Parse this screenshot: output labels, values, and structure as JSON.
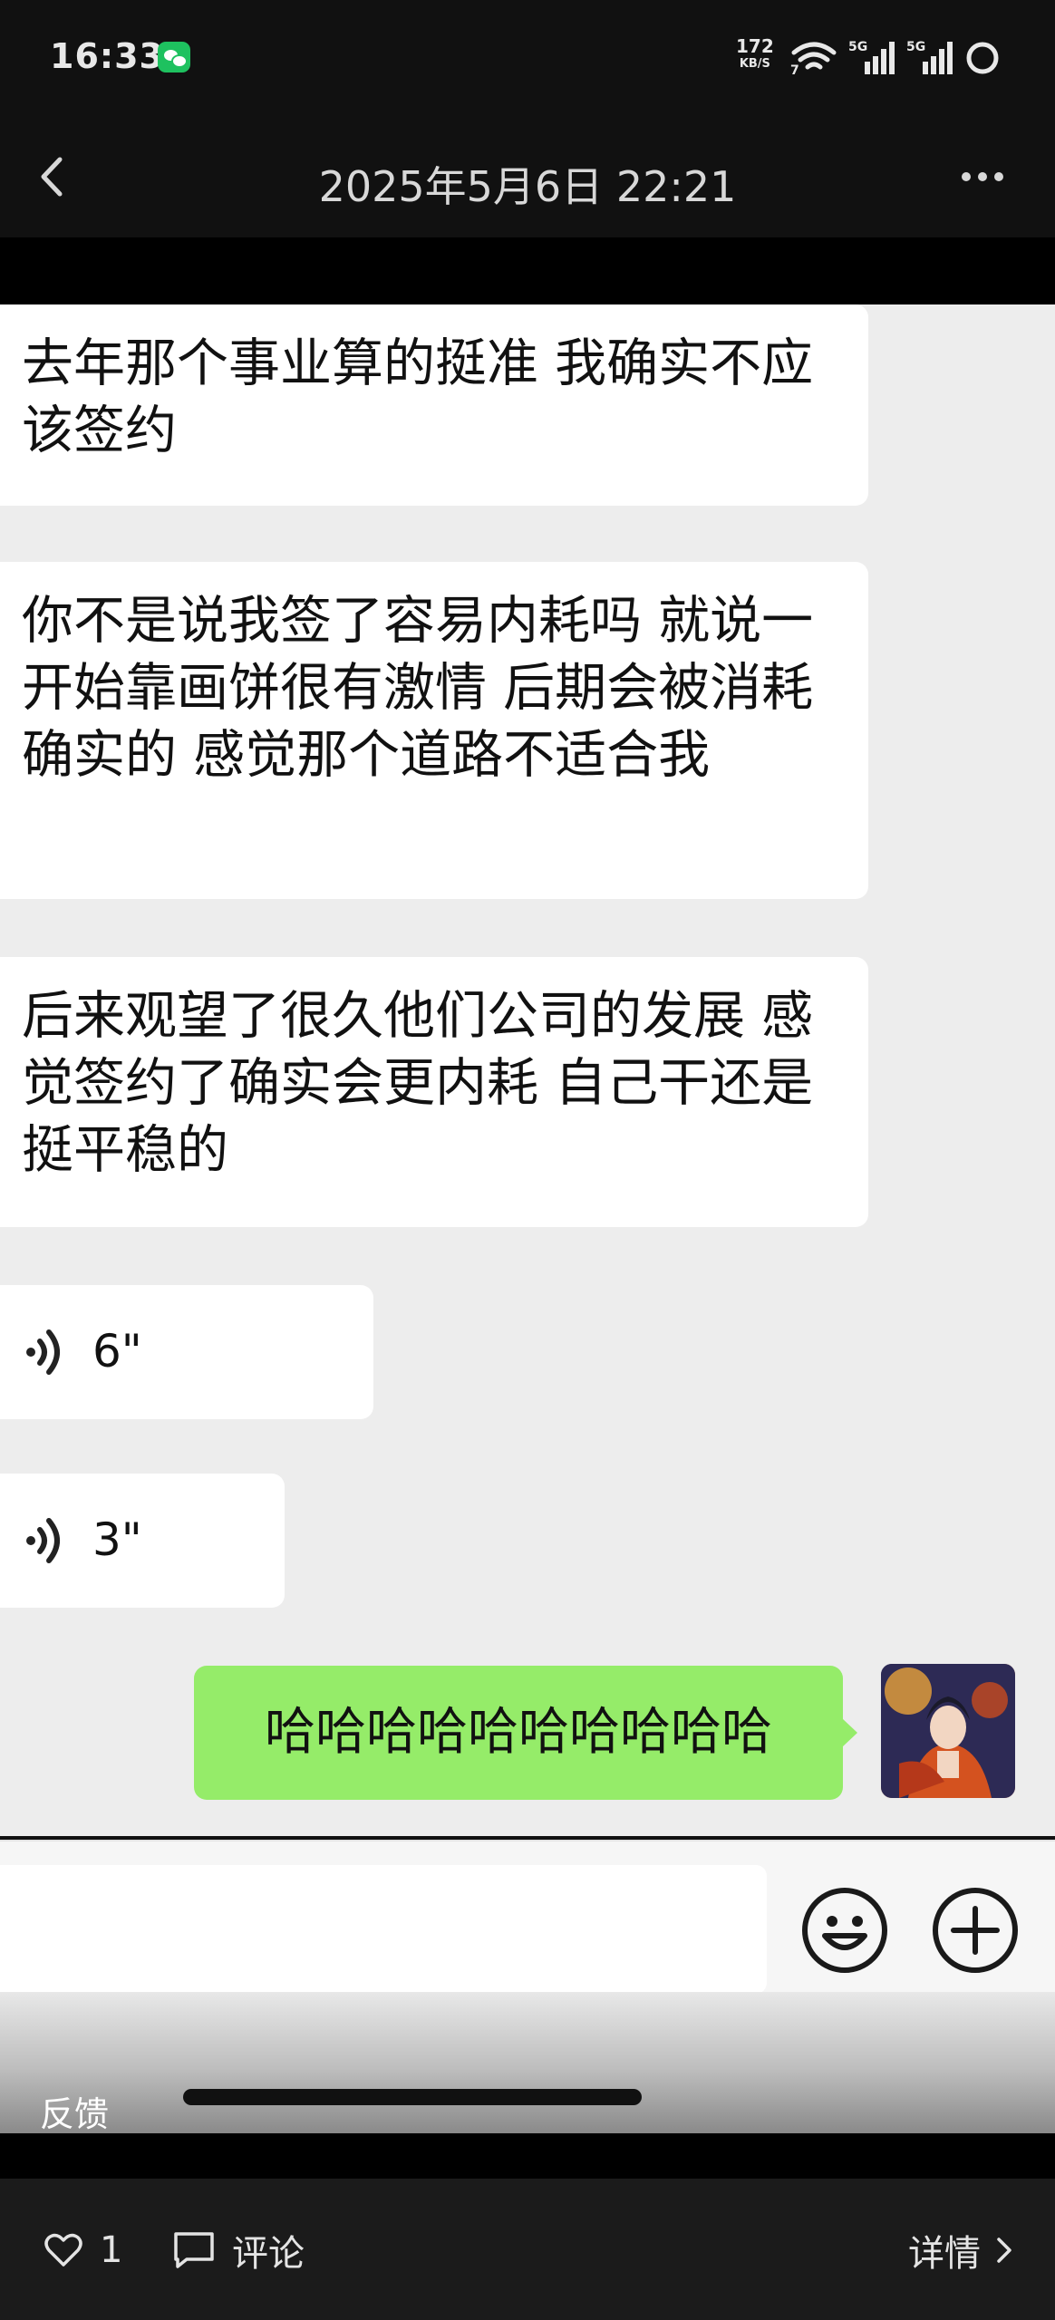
{
  "status_bar": {
    "time": "16:33",
    "net_speed_value": "172",
    "net_speed_unit": "KB/S",
    "wifi_label": "7",
    "signal1_label": "5G",
    "signal2_label": "5G"
  },
  "nav": {
    "title": "2025年5月6日 22:21"
  },
  "messages": [
    {
      "type": "text",
      "side": "left",
      "text": "去年那个事业算的挺准 我确实不应该签约"
    },
    {
      "type": "text",
      "side": "left",
      "text": "你不是说我签了容易内耗吗 就说一开始靠画饼很有激情 后期会被消耗 确实的 感觉那个道路不适合我"
    },
    {
      "type": "text",
      "side": "left",
      "text": "后来观望了很久他们公司的发展 感觉签约了确实会更内耗 自己干还是挺平稳的"
    },
    {
      "type": "voice",
      "side": "left",
      "duration": "6\""
    },
    {
      "type": "voice",
      "side": "left",
      "duration": "3\""
    },
    {
      "type": "text",
      "side": "right",
      "text": "哈哈哈哈哈哈哈哈哈哈"
    }
  ],
  "input_bar": {
    "placeholder": ""
  },
  "overlay": {
    "feedback": "反馈"
  },
  "bottom_bar": {
    "like_count": "1",
    "comment_label": "评论",
    "details_label": "详情"
  },
  "colors": {
    "chat_bg": "#ededed",
    "left_bubble": "#ffffff",
    "right_bubble": "#95ec69",
    "bar_bg": "#111111"
  }
}
